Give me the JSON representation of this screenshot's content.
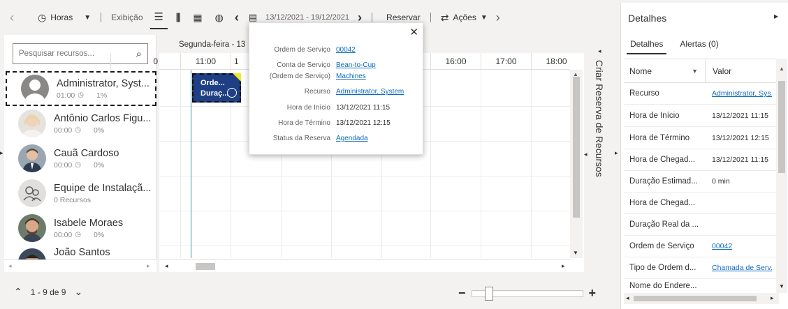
{
  "toolbar": {
    "hours_label": "Horas",
    "view_label": "Exibição",
    "date_range": "13/12/2021 - 19/12/2021",
    "book_label": "Reservar",
    "actions_label": "Ações"
  },
  "search": {
    "placeholder": "Pesquisar recursos..."
  },
  "resources": [
    {
      "name": "Administrator, Syst...",
      "time": "01:00",
      "pct": "1%"
    },
    {
      "name": "Antônio Carlos Figu...",
      "time": "00:00",
      "pct": "0%"
    },
    {
      "name": "Cauã Cardoso",
      "time": "00:00",
      "pct": "0%"
    },
    {
      "name": "Equipe de Instalaçã...",
      "meta": "0 Recursos"
    },
    {
      "name": "Isabele Moraes",
      "time": "00:00",
      "pct": "0%"
    },
    {
      "name": "João Santos"
    }
  ],
  "grid": {
    "date_label": "Segunda-feira - 13",
    "hours": [
      "0",
      "11:00",
      "1",
      "16:00",
      "17:00",
      "18:00"
    ]
  },
  "booking": {
    "line1": "Orde...",
    "line2": "Duraç..."
  },
  "side_tab": {
    "label": "Criar Reserva de Recursos"
  },
  "pager": {
    "label": "1 - 9 de 9"
  },
  "popup": {
    "rows": [
      {
        "label": "Ordem de Serviço",
        "value": "00042",
        "link": true
      },
      {
        "label": "Conta de Serviço",
        "value": "Bean-to-Cup",
        "link": true
      },
      {
        "label": "(Ordem de Serviço)",
        "value": "Machines",
        "link": true
      },
      {
        "label": "Recurso",
        "value": "Administrator, System",
        "link": true
      },
      {
        "label": "Hora de Início",
        "value": "13/12/2021 11:15",
        "link": false
      },
      {
        "label": "Hora de Término",
        "value": "13/12/2021 12:15",
        "link": false
      },
      {
        "label": "Status da Reserva",
        "value": "Agendada",
        "link": true
      }
    ]
  },
  "details": {
    "title": "Detalhes",
    "tabs": [
      "Detalhes",
      "Alertas (0)"
    ],
    "col_name": "Nome",
    "col_value": "Valor",
    "rows": [
      {
        "name": "Recurso",
        "value": "Administrator, Sys...",
        "link": true
      },
      {
        "name": "Hora de Início",
        "value": "13/12/2021 11:15",
        "link": false
      },
      {
        "name": "Hora de Término",
        "value": "13/12/2021 12:15",
        "link": false
      },
      {
        "name": "Hora de Chegad...",
        "value": "13/12/2021 11:15",
        "link": false
      },
      {
        "name": "Duração Estimad...",
        "value": "0 min",
        "link": false
      },
      {
        "name": "Hora de Chegad...",
        "value": "",
        "link": false
      },
      {
        "name": "Duração Real da ...",
        "value": "",
        "link": false
      },
      {
        "name": "Ordem de Serviço",
        "value": "00042",
        "link": true
      },
      {
        "name": "Tipo de Ordem d...",
        "value": "Chamada de Serv...",
        "link": true
      },
      {
        "name": "Nome do Endere...",
        "value": "",
        "link": false
      }
    ]
  },
  "colors": {
    "accent": "#0f6cbd",
    "booking": "#1f3f84",
    "highlight": "#f0e82a"
  }
}
